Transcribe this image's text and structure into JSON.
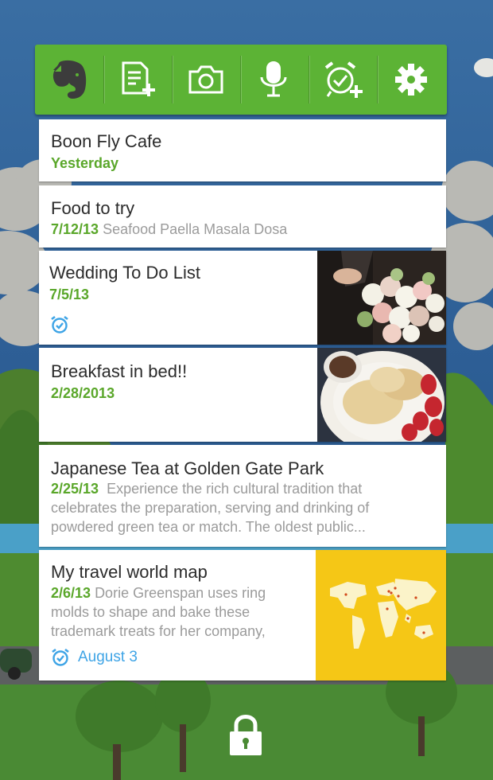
{
  "toolbar": {
    "buttons": [
      {
        "name": "evernote-logo-button",
        "icon": "evernote-elephant-icon"
      },
      {
        "name": "new-text-note-button",
        "icon": "new-note-icon"
      },
      {
        "name": "camera-note-button",
        "icon": "camera-icon"
      },
      {
        "name": "audio-note-button",
        "icon": "microphone-icon"
      },
      {
        "name": "reminder-note-button",
        "icon": "alarm-clock-add-icon"
      },
      {
        "name": "settings-button",
        "icon": "gear-icon"
      }
    ],
    "color": "#5cb335"
  },
  "notes": [
    {
      "title": "Boon Fly Cafe",
      "date": "Yesterday",
      "snippet": ""
    },
    {
      "title": "Food to try",
      "date": "7/12/13",
      "snippet": "Seafood Paella  Masala Dosa"
    },
    {
      "title": "Wedding To Do List",
      "date": "7/5/13",
      "snippet": "",
      "reminder": true,
      "thumbnail": "bouquet-photo"
    },
    {
      "title": "Breakfast in bed!!",
      "date": "2/28/2013",
      "snippet": "",
      "thumbnail": "pancakes-photo"
    },
    {
      "title": "Japanese Tea at Golden Gate Park",
      "date": "2/25/13",
      "snippet_lines": [
        "Experience the rich cultural tradition that",
        "celebrates the preparation, serving and drinking of",
        "powdered green tea or match. The oldest public..."
      ]
    },
    {
      "title": "My travel world map",
      "date": "2/6/13",
      "snippet_lines": [
        "Dorie Greenspan uses ring",
        "molds to shape and bake these",
        "trademark treats for her company,"
      ],
      "reminder_label": "August 3",
      "thumbnail": "world-map"
    }
  ],
  "colors": {
    "accent_green": "#5aa72a",
    "reminder_blue": "#3ea4e6",
    "map_yellow": "#f5c716"
  },
  "lock": {
    "icon": "lock-icon"
  }
}
